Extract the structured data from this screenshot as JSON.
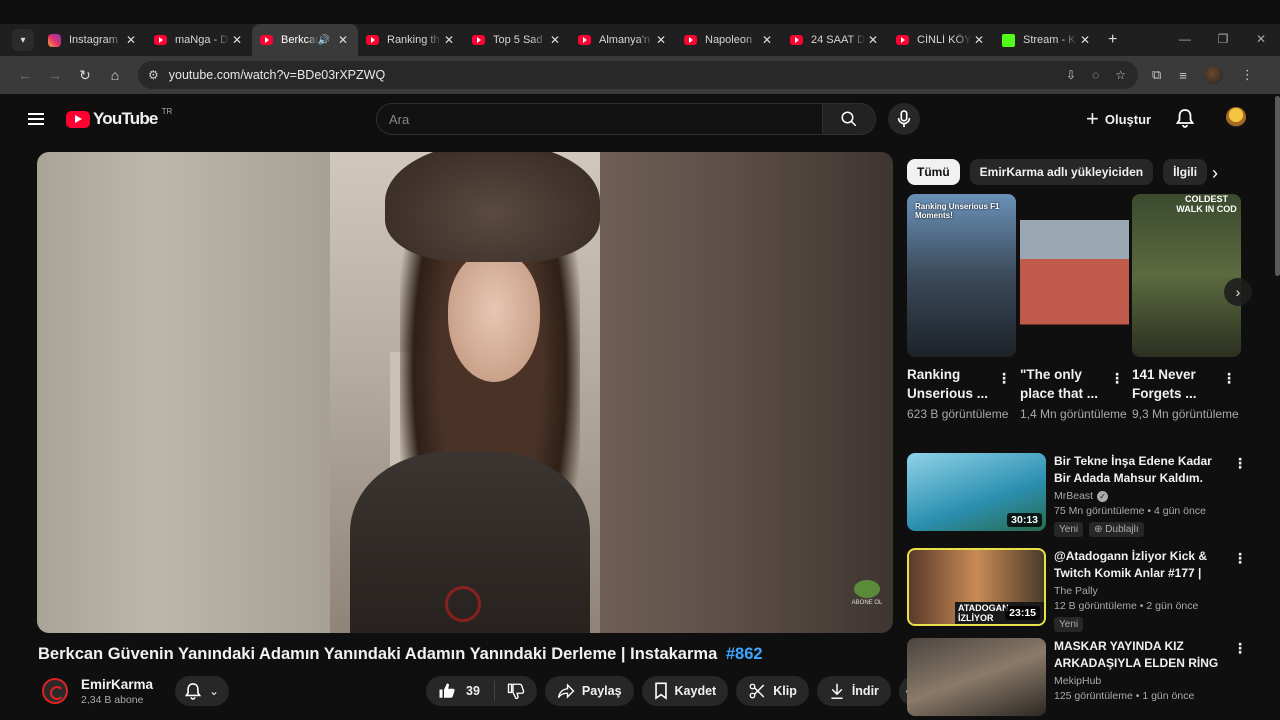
{
  "browser": {
    "tabs": [
      {
        "label": "Instagram",
        "icon": "instagram-icon"
      },
      {
        "label": "maNga - D",
        "icon": "youtube-icon"
      },
      {
        "label": "Berkcan",
        "icon": "youtube-icon",
        "active": true
      },
      {
        "label": "Ranking th",
        "icon": "youtube-icon"
      },
      {
        "label": "Top 5 Sad",
        "icon": "youtube-icon"
      },
      {
        "label": "Almanya'n",
        "icon": "youtube-icon"
      },
      {
        "label": "Napoleon",
        "icon": "youtube-icon"
      },
      {
        "label": "24 SAAT D",
        "icon": "youtube-icon"
      },
      {
        "label": "CİNLİ KÖY",
        "icon": "youtube-icon"
      },
      {
        "label": "Stream - K",
        "icon": "kick-icon"
      }
    ],
    "url": "youtube.com/watch?v=BDe03rXPZWQ"
  },
  "header": {
    "logo_text": "YouTube",
    "region": "TR",
    "search_placeholder": "Ara",
    "create_label": "Oluştur"
  },
  "video": {
    "title": "Berkcan Güvenin Yanındaki Adamın Yanındaki Adamın Yanındaki Derleme | Instakarma",
    "hashtag": "#862",
    "watermark_text": "ABONE OL"
  },
  "channel": {
    "name": "EmirKarma",
    "subscribers": "2,34 B abone"
  },
  "actions": {
    "likes": "39",
    "share": "Paylaş",
    "save": "Kaydet",
    "clip": "Klip",
    "download": "İndir"
  },
  "chips": [
    "Tümü",
    "EmirKarma adlı yükleyiciden",
    "İlgili"
  ],
  "shorts": [
    {
      "title": "Ranking Unserious ...",
      "views": "623 B görüntüleme",
      "caption": "Ranking Unserious F1 Moments!"
    },
    {
      "title": "\"The only place that ...",
      "views": "1,4 Mn görüntüleme",
      "caption": ""
    },
    {
      "title": "141 Never Forgets ...",
      "views": "9,3 Mn görüntüleme",
      "caption": "COLDEST WALK IN COD"
    }
  ],
  "recommendations": [
    {
      "title": "Bir Tekne İnşa Edene Kadar Bir Adada Mahsur Kaldım.",
      "channel": "MrBeast",
      "verified": true,
      "stats": "75 Mn görüntüleme • 4 gün önce",
      "duration": "30:13",
      "badges": [
        "Yeni",
        "Dublajlı"
      ]
    },
    {
      "title": "@Atadogann İzliyor Kick & Twitch Komik Anlar #177 | The...",
      "channel": "The Pally",
      "verified": false,
      "stats": "12 B görüntüleme • 2 gün önce",
      "duration": "23:15",
      "badges": [
        "Yeni"
      ],
      "thumb_label": "ATADOGAN İZLİYOR"
    },
    {
      "title": "MASKAR YAYINDA KIZ ARKADAŞIYLA ELDEN RİNG ...",
      "channel": "MekipHub",
      "verified": false,
      "stats": "125 görüntüleme • 1 gün önce",
      "duration": "",
      "badges": []
    }
  ]
}
